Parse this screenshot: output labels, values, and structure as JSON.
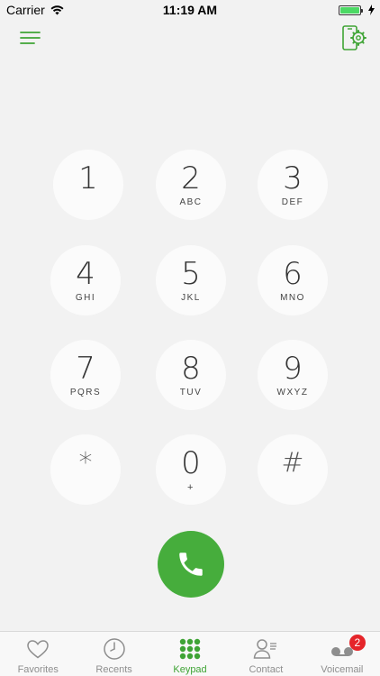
{
  "status_bar": {
    "carrier": "Carrier",
    "time": "11:19 AM"
  },
  "top_bar": {
    "menu_icon": "hamburger-menu-icon",
    "settings_icon": "phone-settings-icon"
  },
  "keypad": {
    "keys": [
      {
        "digit": "1",
        "letters": ""
      },
      {
        "digit": "2",
        "letters": "ABC"
      },
      {
        "digit": "3",
        "letters": "DEF"
      },
      {
        "digit": "4",
        "letters": "GHI"
      },
      {
        "digit": "5",
        "letters": "JKL"
      },
      {
        "digit": "6",
        "letters": "MNO"
      },
      {
        "digit": "7",
        "letters": "PQRS"
      },
      {
        "digit": "8",
        "letters": "TUV"
      },
      {
        "digit": "9",
        "letters": "WXYZ"
      },
      {
        "digit": "*",
        "letters": ""
      },
      {
        "digit": "0",
        "letters": "+"
      },
      {
        "digit": "#",
        "letters": ""
      }
    ]
  },
  "call_button": {
    "icon": "phone-icon",
    "color": "#46ad3c"
  },
  "tab_bar": {
    "tabs": [
      {
        "label": "Favorites",
        "icon": "heart-icon",
        "active": false
      },
      {
        "label": "Recents",
        "icon": "clock-icon",
        "active": false
      },
      {
        "label": "Keypad",
        "icon": "keypad-icon",
        "active": true
      },
      {
        "label": "Contact",
        "icon": "contact-icon",
        "active": false
      },
      {
        "label": "Voicemail",
        "icon": "voicemail-icon",
        "active": false,
        "badge": "2"
      }
    ]
  },
  "colors": {
    "accent": "#3fa435",
    "badge": "#e5252a",
    "background": "#f2f2f2"
  }
}
